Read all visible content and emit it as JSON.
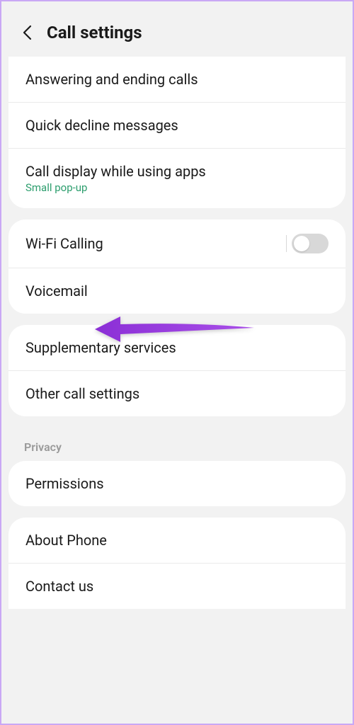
{
  "header": {
    "title": "Call settings"
  },
  "group1": {
    "answering": "Answering and ending calls",
    "quickDecline": "Quick decline messages",
    "callDisplay": "Call display while using apps",
    "callDisplaySub": "Small pop-up"
  },
  "group2": {
    "wifiCalling": "Wi-Fi Calling",
    "voicemail": "Voicemail"
  },
  "group3": {
    "supplementary": "Supplementary services",
    "otherCall": "Other call settings"
  },
  "section": {
    "privacy": "Privacy"
  },
  "group4": {
    "permissions": "Permissions"
  },
  "group5": {
    "aboutPhone": "About Phone",
    "contactUs": "Contact us"
  }
}
